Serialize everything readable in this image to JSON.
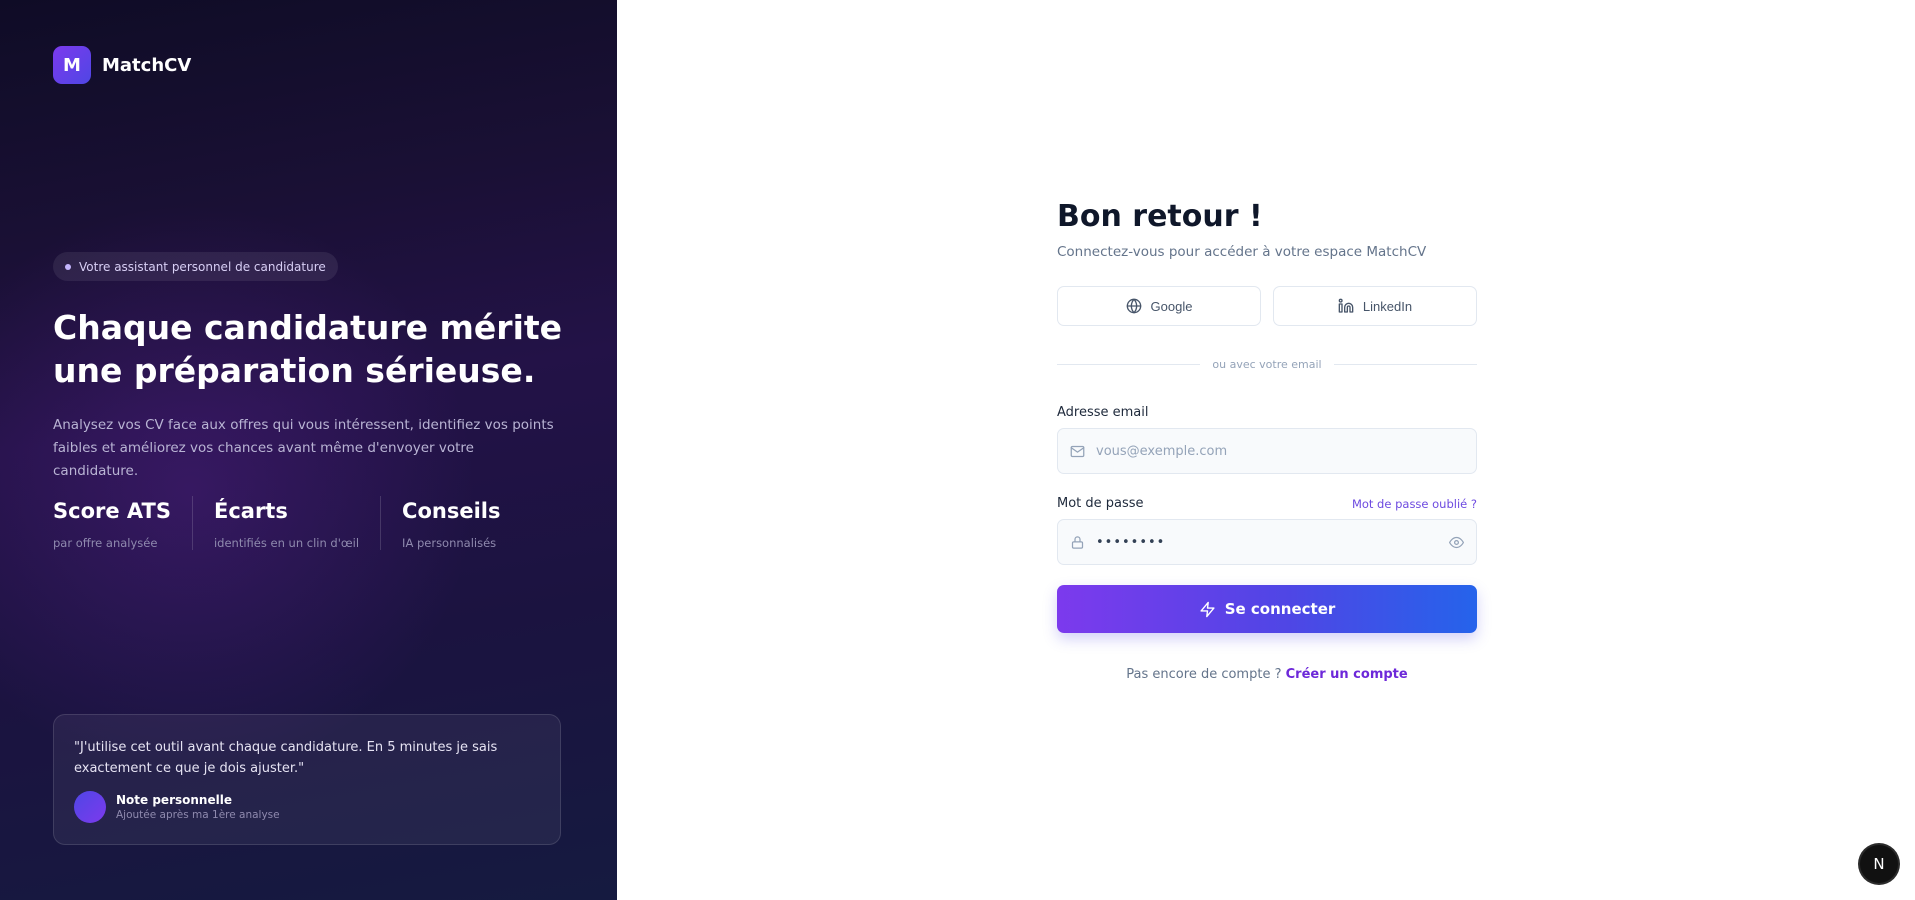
{
  "brand": {
    "logo_letter": "M",
    "name": "MatchCV"
  },
  "hero": {
    "badge": "Votre assistant personnel de candidature",
    "headline": "Chaque candidature mérite une préparation sérieuse.",
    "lead": "Analysez vos CV face aux offres qui vous intéressent, identifiez vos points faibles et améliorez vos chances avant même d'envoyer votre candidature.",
    "stats": [
      {
        "title": "Score ATS",
        "sub": "par offre analysée"
      },
      {
        "title": "Écarts",
        "sub": "identifiés en un clin d'œil"
      },
      {
        "title": "Conseils",
        "sub": "IA personnalisés"
      }
    ]
  },
  "testimonial": {
    "quote": "\"J'utilise cet outil avant chaque candidature. En 5 minutes je sais exactement ce que je dois ajuster.\"",
    "author": "Note personnelle",
    "author_sub": "Ajoutée après ma 1ère analyse"
  },
  "form": {
    "title": "Bon retour !",
    "subtitle": "Connectez-vous pour accéder à votre espace MatchCV",
    "google_label": "Google",
    "linkedin_label": "LinkedIn",
    "divider": "ou avec votre email",
    "email_label": "Adresse email",
    "email_placeholder": "vous@exemple.com",
    "password_label": "Mot de passe",
    "forgot_label": "Mot de passe oublié ?",
    "password_value": "password",
    "submit_label": "Se connecter",
    "signup_prompt": "Pas encore de compte ?",
    "signup_link": "Créer un compte"
  },
  "dev_badge": "N",
  "colors": {
    "accent": "#6d28d9",
    "button_gradient_start": "#7c3aed",
    "button_gradient_end": "#2563eb",
    "left_panel_bg": "#1a1035"
  },
  "icons": {
    "google": "globe-icon",
    "linkedin": "linkedin-icon",
    "email": "mail-icon",
    "password": "lock-icon",
    "toggle_password": "eye-icon",
    "submit": "lightning-icon"
  }
}
